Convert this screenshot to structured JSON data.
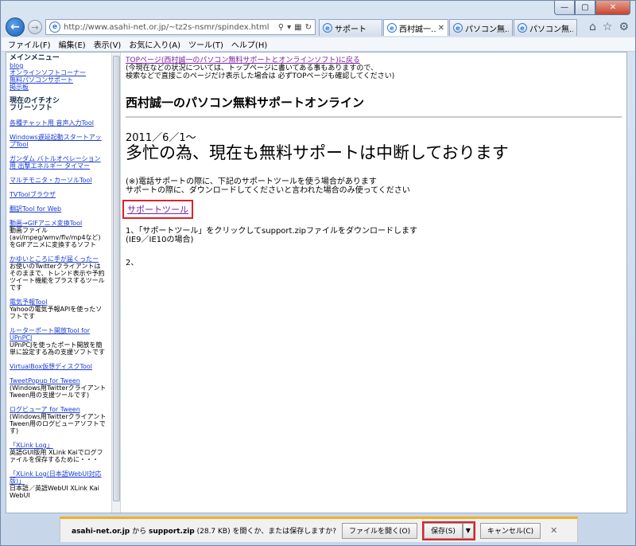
{
  "window": {
    "caption_buttons": {
      "minimize": "—",
      "maximize": "▢",
      "close": "✕"
    }
  },
  "nav": {
    "address": "http://www.asahi-net.or.jp/~tz2s-nsmr/spindex.html",
    "tabs": [
      {
        "label": "サポート",
        "active": false,
        "closable": false
      },
      {
        "label": "西村誠一…",
        "active": true,
        "closable": true
      },
      {
        "label": "パソコン無…",
        "active": false,
        "closable": false
      },
      {
        "label": "パソコン無…",
        "active": false,
        "closable": false
      }
    ]
  },
  "menu": [
    "ファイル(F)",
    "編集(E)",
    "表示(V)",
    "お気に入り(A)",
    "ツール(T)",
    "ヘルプ(H)"
  ],
  "sidebar": {
    "main_menu_title": "メインメニュー",
    "main_links": [
      "blog",
      "オンラインソフトコーナー",
      "無料パソコンサポート",
      "掲示板"
    ],
    "featured_title_1": "現在のイチオシ",
    "featured_title_2": "フリーソフト",
    "entries": [
      {
        "title": "各種チャット用 音声入力Tool",
        "desc": ""
      },
      {
        "title": "Windows遅延起動スタートアップTool",
        "desc": ""
      },
      {
        "title": "ガンダム バトルオペレーション用 出撃エネルギー タイマー",
        "desc": ""
      },
      {
        "title": "マルチモニタ・カーソルTool",
        "desc": ""
      },
      {
        "title": "TVToolブラウザ",
        "desc": ""
      },
      {
        "title": "翻訳Tool for Web",
        "desc": ""
      },
      {
        "title": "動画→GIFアニメ変換Tool",
        "desc": "動画ファイル(avi/mpeg/wmv/flv/mp4など)をGIFアニメに変換するソフト"
      },
      {
        "title": "かゆいところに手が届くったー",
        "desc": "お使いのTwitterクライアントはそのままで、トレンド表示や予約ツイート機能をプラスするツールです"
      },
      {
        "title": "電気予報Tool",
        "desc": "Yahooの電気予報APIを使ったソフトです"
      },
      {
        "title": "ルーターポート開放Tool for UPnPCJ",
        "desc": "UPnPCJを使ったポート開放を簡単に設定する為の支援ソフトです"
      },
      {
        "title": "VirtualBox仮想ディスクTool",
        "desc": ""
      },
      {
        "title": "TweetPopup for Tween",
        "desc": "(Windows用TwitterクライアントTween用の支援ツールです)"
      },
      {
        "title": "ログビューア for Tween",
        "desc": "(Windows用TwitterクライアントTween用のログビューアソフトです)"
      },
      {
        "title": "「XLink Log」",
        "desc": "英語GUI版用 XLink Kaiでログファイルを保存するために・・・"
      },
      {
        "title": "「XLink Log(日本語WebUI対応版)」",
        "desc": "日本語／英語WebUI XLink Kai WebUI"
      }
    ]
  },
  "main": {
    "top_link": "TOPページ(西村誠一のパソコン無料サポートとオンラインソフト)に戻る",
    "top_note_1": "(今現在などの状況については、トップページに書いてある事もありますので、",
    "top_note_2": "検索などで直接このページだけ表示した場合は 必ずTOPページも確認してください)",
    "site_title": "西村誠一のパソコン無料サポートオンライン",
    "date": "2011／6／1〜",
    "headline": "多忙の為、現在も無料サポートは中断しております",
    "notice_1": "(※)電話サポートの際に、下記のサポートツールを使う場合があります",
    "notice_2": "サポートの際に、ダウンロードしてくださいと言われた場合のみ使ってください",
    "support_link": "サポートツール",
    "step1_1": "1、「サポートツール」をクリックしてsupport.zipファイルをダウンロードします",
    "step1_2": "(IE9／IE10の場合)",
    "step2": "2、"
  },
  "download_bar": {
    "site": "asahi-net.or.jp",
    "from": " から ",
    "file": "support.zip",
    "size_and_question": " (28.7 KB) を開くか、または保存しますか?",
    "open_label": "ファイルを開く(O)",
    "save_label": "保存(S)",
    "dropdown_label": "▼",
    "cancel_label": "キャンセル(C)",
    "close_label": "✕"
  },
  "colors": {
    "accent_border": "#f0b020",
    "highlight_red": "#e2202a",
    "visited_link": "#7b1fa2",
    "sidebar_link": "#1a3bd4"
  }
}
